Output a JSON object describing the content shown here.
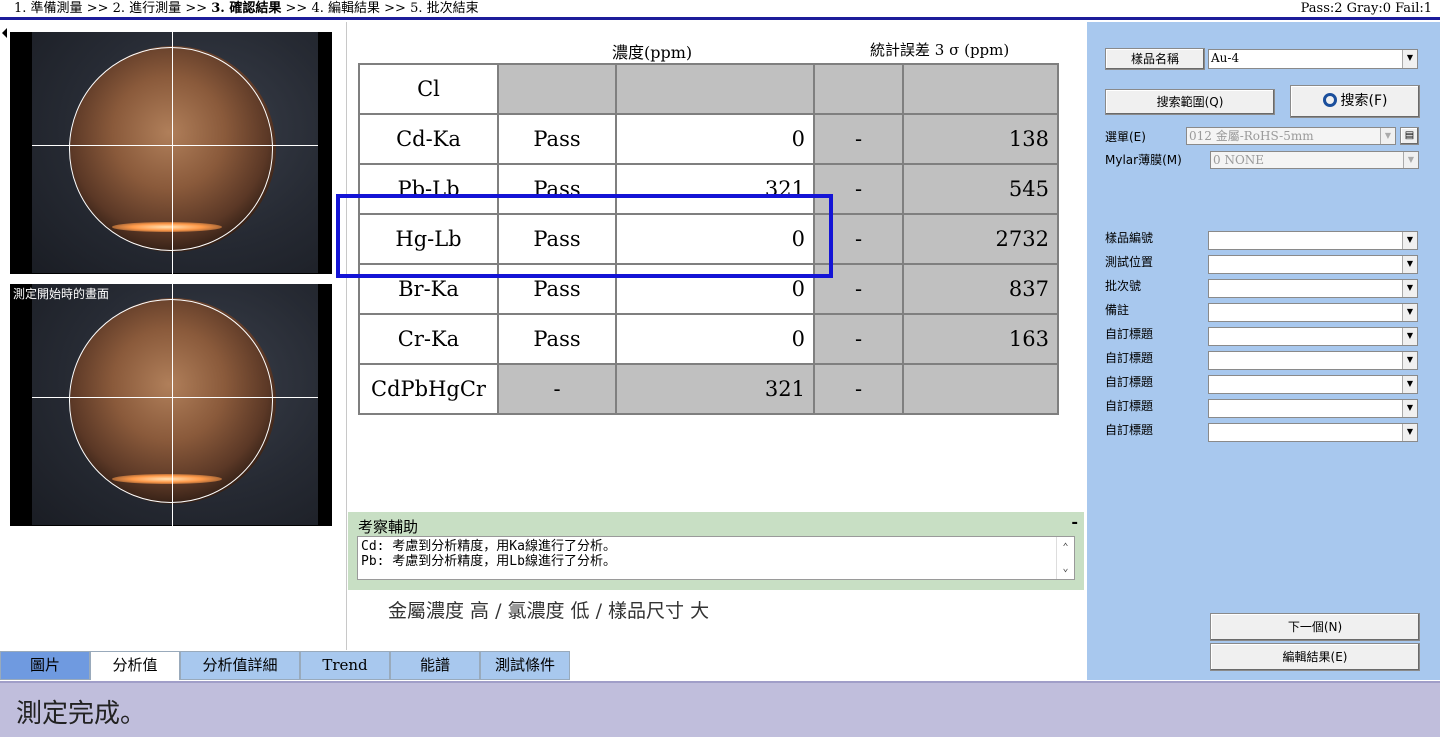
{
  "steps": {
    "s1": "1. 準備測量",
    "s2": "2. 進行測量",
    "s3": "3. 確認結果",
    "s4": "4. 編輯結果",
    "s5": "5. 批次結束",
    "sep": ">>"
  },
  "stats": "Pass:2  Gray:0  Fail:1",
  "camera": {
    "caption_start": "測定開始時的畫面"
  },
  "table": {
    "header_conc": "濃度(ppm)",
    "header_err": "統計誤差 3 σ (ppm)",
    "rows": [
      {
        "el": "Cl",
        "pf": "",
        "val": "",
        "dash": "",
        "err": ""
      },
      {
        "el": "Cd-Ka",
        "pf": "Pass",
        "val": "0",
        "dash": "-",
        "err": "138"
      },
      {
        "el": "Pb-Lb",
        "pf": "Pass",
        "val": "321",
        "dash": "-",
        "err": "545"
      },
      {
        "el": "Hg-Lb",
        "pf": "Pass",
        "val": "0",
        "dash": "-",
        "err": "2732"
      },
      {
        "el": "Br-Ka",
        "pf": "Pass",
        "val": "0",
        "dash": "-",
        "err": "837"
      },
      {
        "el": "Cr-Ka",
        "pf": "Pass",
        "val": "0",
        "dash": "-",
        "err": "163"
      },
      {
        "el": "CdPbHgCr",
        "pf": "-",
        "val": "321",
        "dash": "-",
        "err": ""
      }
    ]
  },
  "remarks": {
    "title": "考察輔助",
    "minimize": "-",
    "line1": "Cd: 考慮到分析精度，用Ka線進行了分析。",
    "line2": "Pb: 考慮到分析精度，用Lb線進行了分析。"
  },
  "summary": "金屬濃度 高 / 氯濃度 低 / 樣品尺寸 大",
  "panel": {
    "sample_name_btn": "樣品名稱",
    "sample_name_val": "Au-4",
    "search_range_btn": "搜索範圍(Q)",
    "search_btn": "搜索(F)",
    "menu_label": "選單(E)",
    "menu_val": "012 金屬-RoHS-5mm",
    "mylar_label": "Mylar薄膜(M)",
    "mylar_val": "0 NONE",
    "fields": [
      {
        "label": "樣品編號",
        "value": ""
      },
      {
        "label": "測試位置",
        "value": ""
      },
      {
        "label": "批次號",
        "value": ""
      },
      {
        "label": "備註",
        "value": ""
      },
      {
        "label": "自訂標題",
        "value": ""
      },
      {
        "label": "自訂標題",
        "value": ""
      },
      {
        "label": "自訂標題",
        "value": ""
      },
      {
        "label": "自訂標題",
        "value": ""
      },
      {
        "label": "自訂標題",
        "value": ""
      }
    ],
    "next_btn": "下一個(N)",
    "edit_btn": "編輯結果(E)"
  },
  "tabs": [
    "圖片",
    "分析值",
    "分析值詳細",
    "Trend",
    "能譜",
    "測試條件"
  ],
  "status": "測定完成。"
}
